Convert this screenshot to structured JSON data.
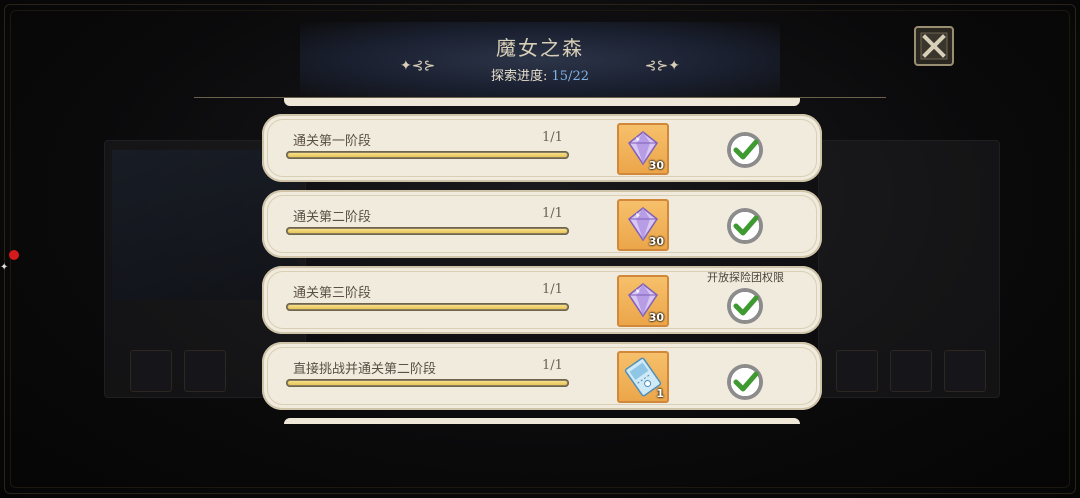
{
  "header": {
    "title": "魔女之森",
    "progress_label": "探索进度: ",
    "progress_value": "15/22"
  },
  "icons": {
    "close": "close-x-icon",
    "check": "check-icon",
    "diamond": "diamond-gem-icon",
    "ticket": "ticket-icon"
  },
  "tasks": [
    {
      "label": "通关第一阶段",
      "count": "1/1",
      "progress": 1.0,
      "reward": "diamond-gem-icon",
      "reward_qty": "30",
      "note": ""
    },
    {
      "label": "通关第二阶段",
      "count": "1/1",
      "progress": 1.0,
      "reward": "diamond-gem-icon",
      "reward_qty": "30",
      "note": ""
    },
    {
      "label": "通关第三阶段",
      "count": "1/1",
      "progress": 1.0,
      "reward": "diamond-gem-icon",
      "reward_qty": "30",
      "note": "开放探险团权限"
    },
    {
      "label": "直接挑战并通关第二阶段",
      "count": "1/1",
      "progress": 1.0,
      "reward": "ticket-icon",
      "reward_qty": "1",
      "note": ""
    }
  ],
  "colors": {
    "accent_gold": "#e8c456",
    "progress_value_blue": "#7fb3e6",
    "check_green": "#3f9a32"
  }
}
